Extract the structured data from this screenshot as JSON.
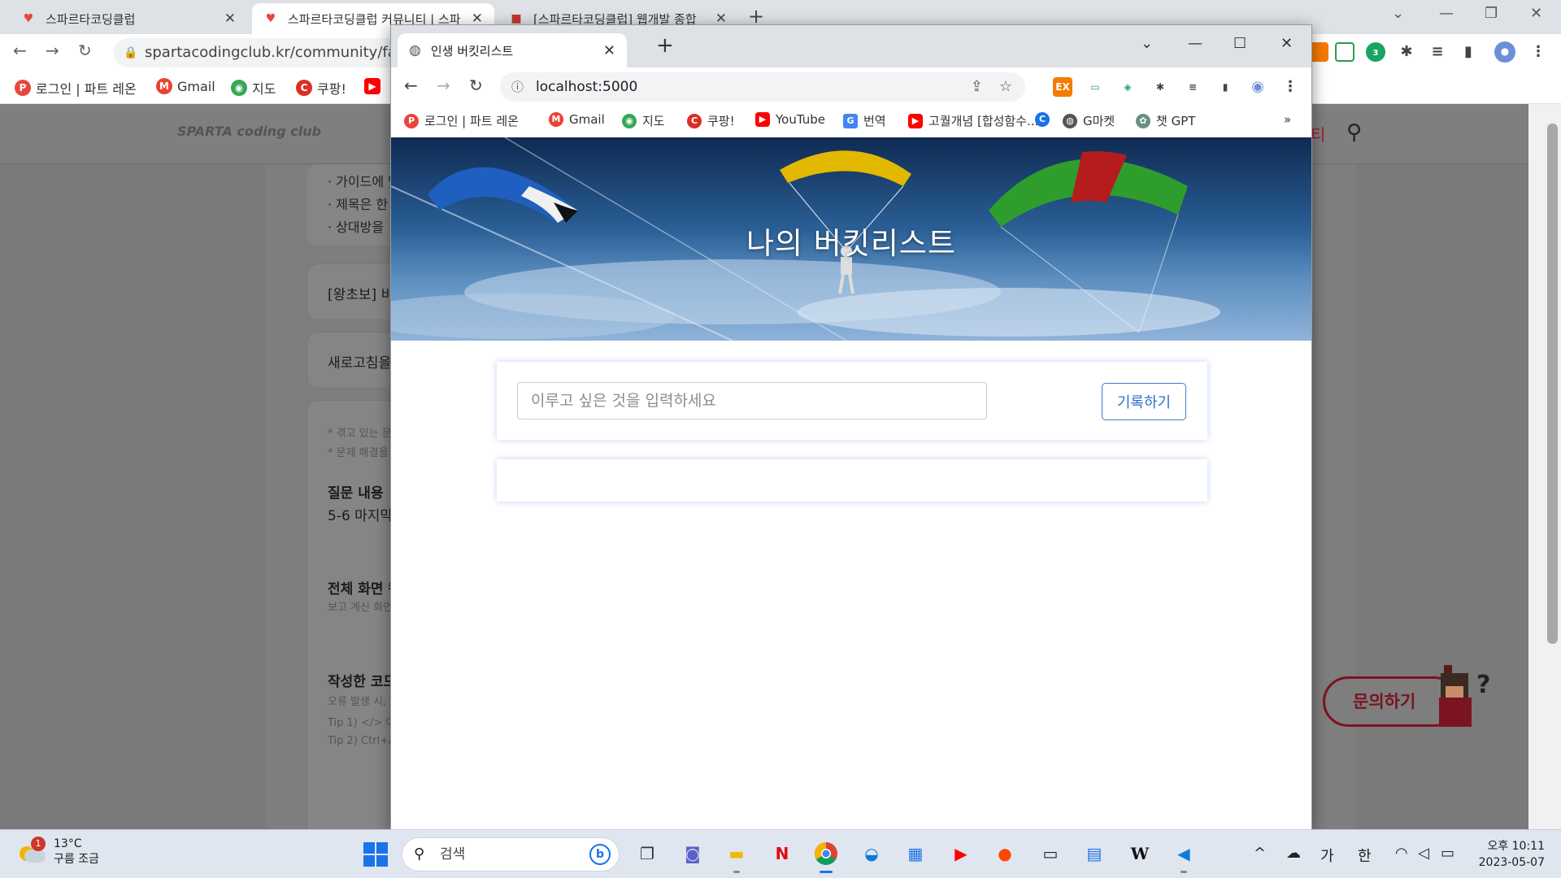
{
  "back_browser": {
    "tabs": [
      {
        "title": "스파르타코딩클럽"
      },
      {
        "title": "스파르타코딩클럽 커뮤니티 | 스파"
      },
      {
        "title": "[스파르타코딩클럽] 웹개발 종합"
      }
    ],
    "url": "spartacodingclub.kr/community/fastqna",
    "bookmarks": [
      "로그인 | 파트 레온",
      "Gmail",
      "지도",
      "쿠팡!",
      ""
    ],
    "ext_badge": "3",
    "page": {
      "logo": "SPARTA coding club",
      "header_right": "티",
      "guide_lines": [
        "· 가이드에 맞",
        "· 제목은 한",
        "· 상대방을"
      ],
      "card1": "[왕초보] 비",
      "card2": "새로고침을",
      "small1": "* 겪고 있는 문",
      "small2": "* 문제 해결을",
      "q_head": "질문 내용",
      "q_text": "5-6 마지막",
      "cap_head": "전체 화면 캡",
      "cap_sub": "보고 계신 화면",
      "code_head": "작성한 코드",
      "code_sub1": "오류 발생 시,",
      "code_sub2": "Tip 1) </> 아",
      "code_sub3": "Tip 2) Ctrl+A",
      "inquiry": "문의하기"
    }
  },
  "front_browser": {
    "tab_title": "인생 버킷리스트",
    "url": "localhost:5000",
    "bookmarks": [
      {
        "label": "로그인 | 파트 레온",
        "color": "#e8453c"
      },
      {
        "label": "Gmail",
        "color": "#ea4335"
      },
      {
        "label": "지도",
        "color": "#34a853"
      },
      {
        "label": "쿠팡!",
        "color": "#d93025"
      },
      {
        "label": "YouTube",
        "color": "#ff0000"
      },
      {
        "label": "번역",
        "color": "#4285f4"
      },
      {
        "label": "고퀄개념 [합성함수...",
        "color": "#ff0000"
      },
      {
        "label": "",
        "color": "#1a73e8"
      },
      {
        "label": "G마켓",
        "color": "#555555"
      },
      {
        "label": "챗 GPT",
        "color": "#6b8f86"
      }
    ],
    "more": "»",
    "extensions": [
      "EX",
      "▭",
      "◈",
      "✱",
      "≡",
      "▮",
      "◉",
      "⋮"
    ],
    "hero_title": "나의 버킷리스트",
    "input_placeholder": "이루고 싶은 것을 입력하세요",
    "save_button": "기록하기"
  },
  "taskbar": {
    "weather_temp": "13°C",
    "weather_desc": "구름 조금",
    "notification_count": "1",
    "search_label": "검색",
    "apps": [
      "task-view",
      "teams",
      "file-explorer",
      "netflix",
      "chrome",
      "edge",
      "store",
      "youtube",
      "reddit",
      "terminal",
      "notepad",
      "wikipedia",
      "vscode"
    ],
    "tray": [
      "^",
      "☁",
      "가",
      "한"
    ],
    "clock_time": "오후 10:11",
    "clock_date": "2023-05-07"
  },
  "colors": {
    "accent_blue": "#2f6fc8",
    "sparta_red": "#a01e2a"
  }
}
